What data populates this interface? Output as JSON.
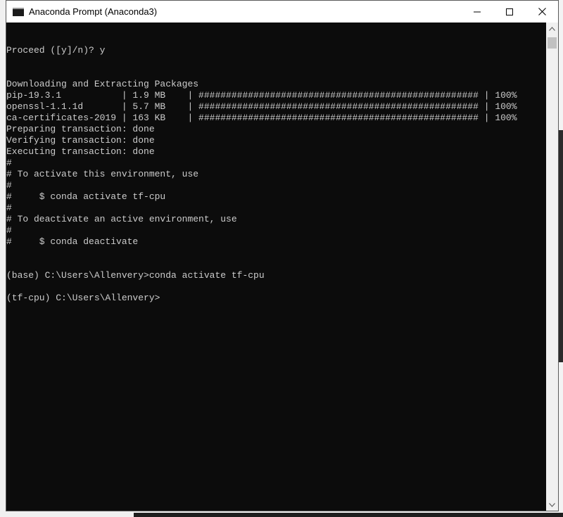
{
  "window": {
    "title": "Anaconda Prompt (Anaconda3)",
    "icons": {
      "app": "console-app-icon",
      "minimize": "minimize-icon",
      "maximize": "maximize-icon",
      "close": "close-icon"
    }
  },
  "console": {
    "lines": [
      "Proceed ([y]/n)? y",
      "",
      "",
      "Downloading and Extracting Packages",
      "pip-19.3.1           | 1.9 MB    | ################################################### | 100%",
      "openssl-1.1.1d       | 5.7 MB    | ################################################### | 100%",
      "ca-certificates-2019 | 163 KB    | ################################################### | 100%",
      "Preparing transaction: done",
      "Verifying transaction: done",
      "Executing transaction: done",
      "#",
      "# To activate this environment, use",
      "#",
      "#     $ conda activate tf-cpu",
      "#",
      "# To deactivate an active environment, use",
      "#",
      "#     $ conda deactivate",
      "",
      "",
      "(base) C:\\Users\\Allenvery>conda activate tf-cpu",
      "",
      "(tf-cpu) C:\\Users\\Allenvery>"
    ]
  },
  "colors": {
    "console_bg": "#0c0c0c",
    "console_text": "#cccccc",
    "titlebar_bg": "#ffffff"
  }
}
